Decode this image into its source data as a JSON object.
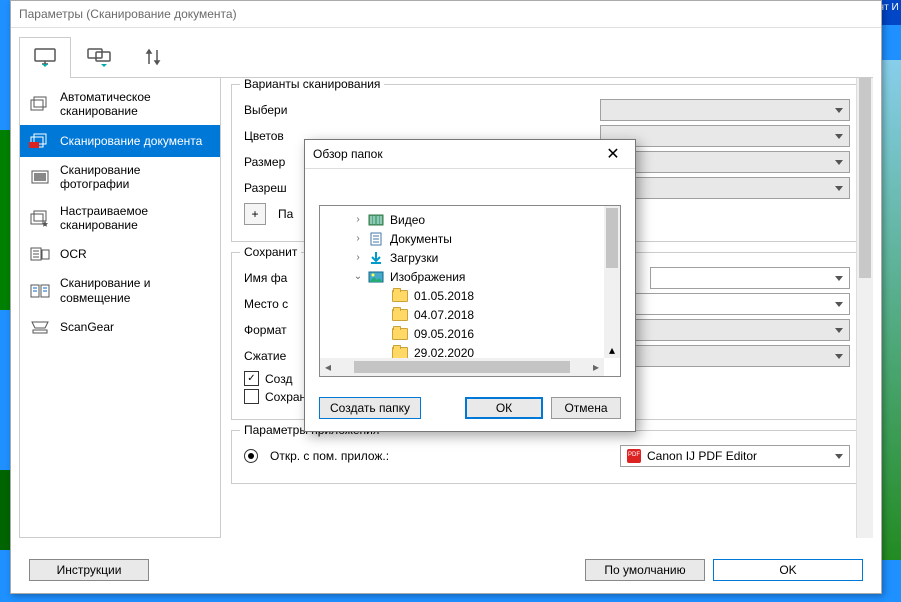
{
  "corner_hint": "ент\nИ",
  "window": {
    "title": "Параметры (Сканирование документа)"
  },
  "sidebar": {
    "items": [
      {
        "label": "Автоматическое сканирование"
      },
      {
        "label": "Сканирование документа"
      },
      {
        "label": "Сканирование фотографии"
      },
      {
        "label": "Настраиваемое сканирование"
      },
      {
        "label": "OCR"
      },
      {
        "label": "Сканирование и совмещение"
      },
      {
        "label": "ScanGear"
      }
    ]
  },
  "groups": {
    "scan": {
      "title": "Варианты сканирования",
      "rows": {
        "select": "Выбери",
        "color": "Цветов",
        "size": "Размер",
        "res": "Разреш",
        "p": "Па"
      }
    },
    "save": {
      "title": "Сохранит",
      "rows": {
        "name": "Имя фа",
        "place": "Место с",
        "format": "Формат",
        "compress": "Сжатие"
      },
      "chk_create": "Созд",
      "chk_subfolder": "Сохранение в подпапку с текущей датой"
    },
    "app": {
      "title": "Параметры приложения",
      "radio_label": "Откр. с пом. прилож.:",
      "combo_value": "Canon IJ PDF Editor"
    }
  },
  "footer": {
    "instructions": "Инструкции",
    "defaults": "По умолчанию",
    "ok": "OK"
  },
  "dialog": {
    "title": "Обзор папок",
    "tree": [
      {
        "label": "Видео",
        "kind": "video",
        "indent": 1,
        "exp": ">"
      },
      {
        "label": "Документы",
        "kind": "doc",
        "indent": 1,
        "exp": ">"
      },
      {
        "label": "Загрузки",
        "kind": "down",
        "indent": 1,
        "exp": ">"
      },
      {
        "label": "Изображения",
        "kind": "pic",
        "indent": 1,
        "exp": "v"
      },
      {
        "label": "01.05.2018",
        "kind": "folder",
        "indent": 2,
        "exp": ""
      },
      {
        "label": "04.07.2018",
        "kind": "folder",
        "indent": 2,
        "exp": ""
      },
      {
        "label": "09.05.2016",
        "kind": "folder",
        "indent": 2,
        "exp": ""
      },
      {
        "label": "29.02.2020",
        "kind": "folder",
        "indent": 2,
        "exp": ""
      }
    ],
    "buttons": {
      "create": "Создать папку",
      "ok": "ОК",
      "cancel": "Отмена"
    }
  }
}
